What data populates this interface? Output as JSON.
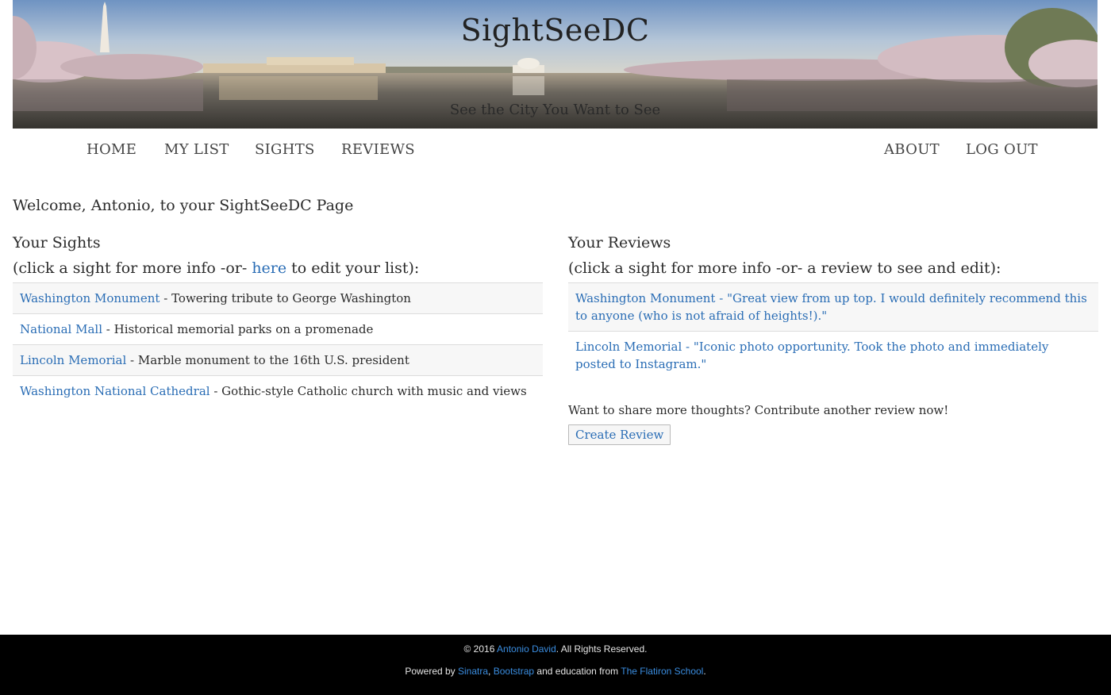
{
  "banner": {
    "title": "SightSeeDC",
    "tagline": "See the City You Want to See"
  },
  "nav": {
    "home": "HOME",
    "my_list": "MY LIST",
    "sights": "SIGHTS",
    "reviews": "REVIEWS",
    "about": "ABOUT",
    "logout": "LOG OUT"
  },
  "welcome": "Welcome, Antonio, to your SightSeeDC Page",
  "sights_panel": {
    "heading": "Your Sights",
    "sub_before": "(click a sight for more info -or- ",
    "sub_link": "here",
    "sub_after": " to edit your list):",
    "items": [
      {
        "name": "Washington Monument",
        "sep": " - ",
        "desc": "Towering tribute to George Washington"
      },
      {
        "name": "National Mall",
        "sep": " - ",
        "desc": "Historical memorial parks on a promenade"
      },
      {
        "name": "Lincoln Memorial",
        "sep": " - ",
        "desc": "Marble monument to the 16th U.S. president"
      },
      {
        "name": "Washington National Cathedral",
        "sep": " - ",
        "desc": "Gothic-style Catholic church with music and views"
      }
    ]
  },
  "reviews_panel": {
    "heading": "Your Reviews",
    "sub": "(click a sight for more info -or- a review to see and edit):",
    "items": [
      {
        "name": "Washington Monument",
        "review": " - \"Great view from up top. I would definitely recommend this to anyone (who is not afraid of heights!).\""
      },
      {
        "name": "Lincoln Memorial",
        "review": " - \"Iconic photo opportunity. Took the photo and immediately posted to Instagram.\""
      }
    ],
    "share_text": "Want to share more thoughts? Contribute another review now!",
    "create_button": "Create Review"
  },
  "footer": {
    "copyright_prefix": "© 2016 ",
    "author": "Antonio David",
    "copyright_suffix": ". All Rights Reserved.",
    "powered_prefix": "Powered by ",
    "sinatra": "Sinatra",
    "comma": ", ",
    "bootstrap": "Bootstrap",
    "education_text": " and education from ",
    "flatiron": "The Flatiron School",
    "period": "."
  },
  "colors": {
    "link": "#2a6db5",
    "footer_link": "#3a8de0",
    "footer_bg": "#000000"
  }
}
